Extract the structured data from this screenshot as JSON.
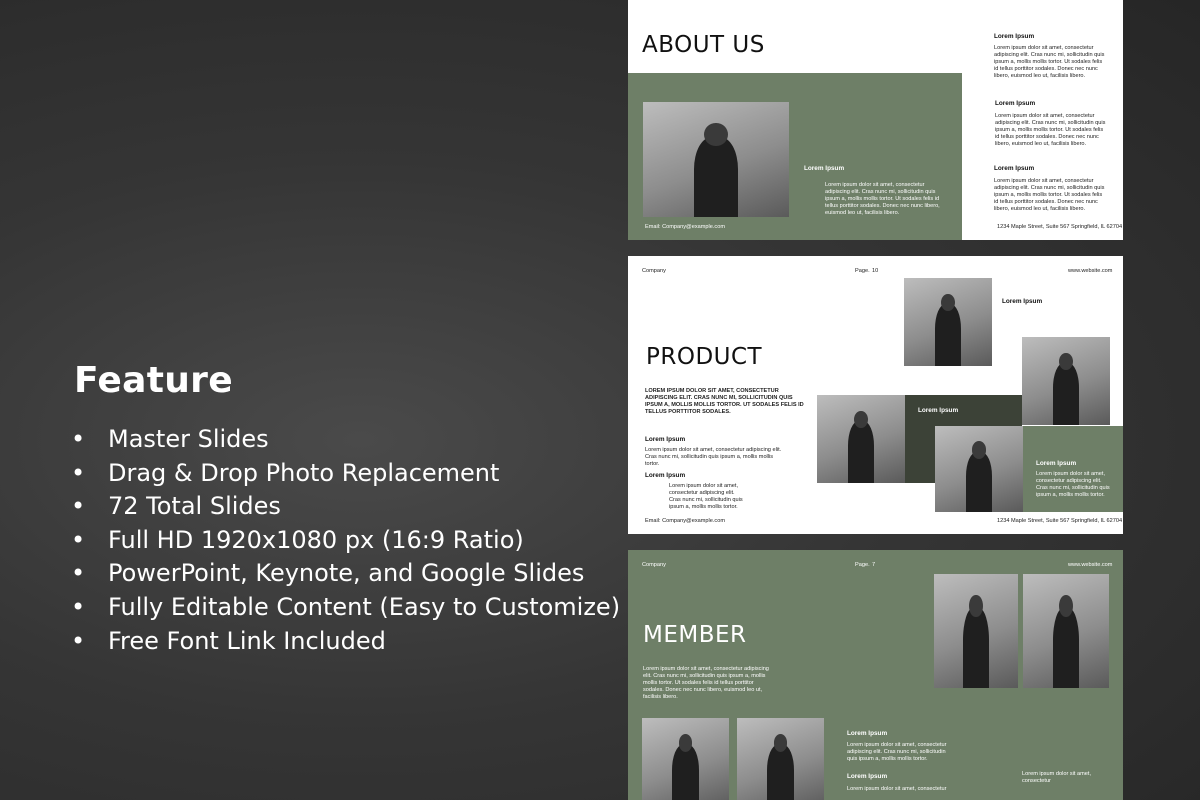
{
  "feature": {
    "title": "Feature",
    "items": [
      "Master Slides",
      "Drag & Drop Photo Replacement",
      "72 Total Slides",
      "Full HD 1920x1080 px (16:9 Ratio)",
      "PowerPoint, Keynote, and Google Slides",
      "Fully Editable Content (Easy to Customize)",
      "Free Font Link Included"
    ]
  },
  "colors": {
    "accent_green": "#6e7f67",
    "dark_green": "#3c4237",
    "background": "#2f2f2f"
  },
  "slide_about": {
    "title": "ABOUT US",
    "left_heading": "Lorem Ipsum",
    "left_text": "Lorem ipsum dolor sit amet, consectetur adipiscing elit. Cras nunc mi, sollicitudin quis ipsum a, mollis mollis tortor. Ut sodales felis id tellus porttitor sodales. Donec nec nunc libero, euismod leo ut, facilisis libero.",
    "email": "Email: Company@example.com",
    "right_blocks": [
      {
        "heading": "Lorem Ipsum",
        "text": "Lorem ipsum dolor sit amet, consectetur adipiscing elit. Cras nunc mi, sollicitudin quis ipsum a, mollis mollis tortor. Ut sodales felis id tellus porttitor sodales. Donec nec nunc libero, euismod leo ut, facilisis libero."
      },
      {
        "heading": "Lorem Ipsum",
        "text": "Lorem ipsum dolor sit amet, consectetur adipiscing elit. Cras nunc mi, sollicitudin quis ipsum a, mollis mollis tortor. Ut sodales felis id tellus porttitor sodales. Donec nec nunc libero, euismod leo ut, facilisis libero."
      },
      {
        "heading": "Lorem Ipsum",
        "text": "Lorem ipsum dolor sit amet, consectetur adipiscing elit. Cras nunc mi, sollicitudin quis ipsum a, mollis mollis tortor. Ut sodales felis id tellus porttitor sodales. Donec nec nunc libero, euismod leo ut, facilisis libero."
      }
    ],
    "address": "1234 Maple Street, Suite 567 Springfield, IL 62704"
  },
  "slide_product": {
    "company": "Company",
    "page_label": "Page.",
    "page_number": "10",
    "website": "www.website.com",
    "title": "PRODUCT",
    "intro": "LOREM IPSUM DOLOR SIT AMET, CONSECTETUR ADIPISCING ELIT. CRAS NUNC MI, SOLLICITUDIN QUIS IPSUM A, MOLLIS MOLLIS TORTOR. UT SODALES FELIS ID TELLUS PORTTITOR SODALES.",
    "block1_heading": "Lorem Ipsum",
    "block1_text": "Lorem ipsum dolor sit amet, consectetur adipiscing elit. Cras nunc mi, sollicitudin quis ipsum a, mollis mollis tortor.",
    "block2_heading": "Lorem Ipsum",
    "block2_text": "Lorem ipsum dolor sit amet, consectetur adipiscing elit. Cras nunc mi, sollicitudin quis ipsum a, mollis mollis tortor.",
    "label_top": "Lorem Ipsum",
    "label_dark": "Lorem Ipsum",
    "label_green_heading": "Lorem Ipsum",
    "label_green_text": "Lorem ipsum dolor sit amet, consectetur adipiscing elit. Cras nunc mi, sollicitudin quis ipsum a, mollis mollis tortor.",
    "email": "Email: Company@example.com",
    "address": "1234 Maple Street, Suite 567 Springfield, IL 62704"
  },
  "slide_member": {
    "company": "Company",
    "page_label": "Page.",
    "page_number": "7",
    "website": "www.website.com",
    "title": "MEMBER",
    "intro": "Lorem ipsum dolor sit amet, consectetur adipiscing elit. Cras nunc mi, sollicitudin quis ipsum a, mollis mollis tortor. Ut sodales felis id tellus porttitor sodales. Donec nec nunc libero, euismod leo ut, facilisis libero.",
    "block1_heading": "Lorem Ipsum",
    "block1_text": "Lorem ipsum dolor sit amet, consectetur adipiscing elit. Cras nunc mi, sollicitudin quis ipsum a, mollis mollis tortor.",
    "block2_heading": "Lorem Ipsum",
    "block2_text": "Lorem ipsum dolor sit amet, consectetur",
    "block3_text": "Lorem ipsum dolor sit amet, consectetur"
  }
}
